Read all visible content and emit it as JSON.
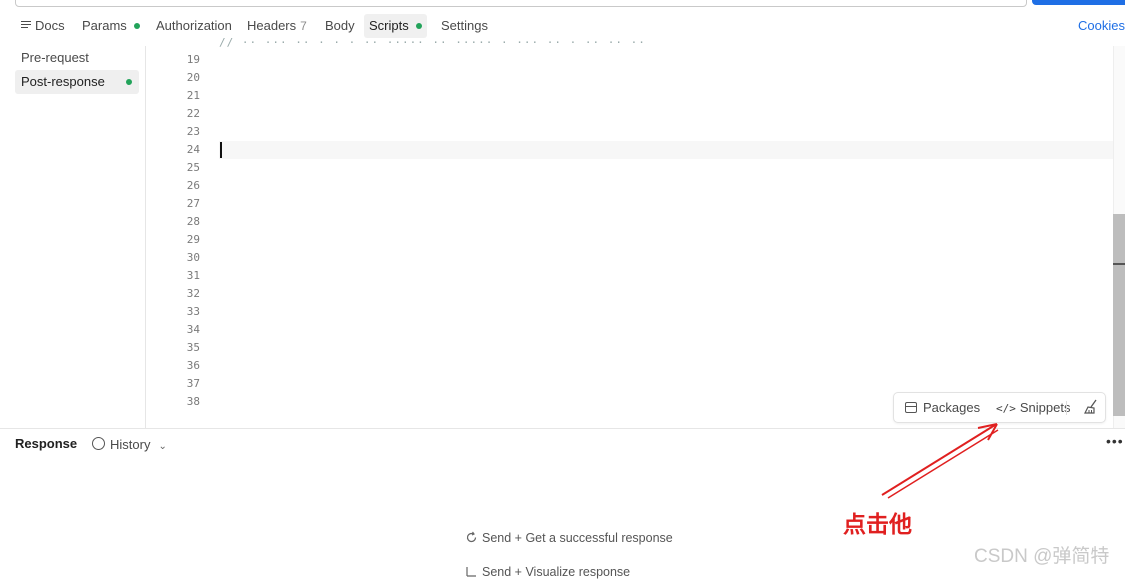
{
  "tabs": [
    {
      "label": "Docs",
      "has_dot": false
    },
    {
      "label": "Params",
      "has_dot": true
    },
    {
      "label": "Authorization",
      "has_dot": false
    },
    {
      "label": "Headers",
      "count": "7"
    },
    {
      "label": "Body",
      "has_dot": false
    },
    {
      "label": "Scripts",
      "has_dot": true,
      "active": true
    },
    {
      "label": "Settings",
      "has_dot": false
    }
  ],
  "cookies_label": "Cookies",
  "sidebar": {
    "items": [
      {
        "label": "Pre-request",
        "active": false
      },
      {
        "label": "Post-response",
        "active": true,
        "has_dot": true
      }
    ]
  },
  "editor": {
    "line_numbers": [
      "19",
      "20",
      "21",
      "22",
      "23",
      "24",
      "25",
      "26",
      "27",
      "28",
      "29",
      "30",
      "31",
      "32",
      "33",
      "34",
      "35",
      "36",
      "37",
      "38"
    ],
    "cursor_line": "24"
  },
  "toolbar": {
    "packages_label": "Packages",
    "snippets_label": "Snippets"
  },
  "response": {
    "title": "Response",
    "history_label": "History",
    "hints": [
      "Send + Get a successful response",
      "Send + Visualize response"
    ]
  },
  "annotation": {
    "text": "点击他",
    "color": "#e02020"
  },
  "watermark": "CSDN @弹简特",
  "colors": {
    "accent": "#1f6fe5",
    "status_dot": "#22a35a",
    "annotation_red": "#e02020"
  }
}
